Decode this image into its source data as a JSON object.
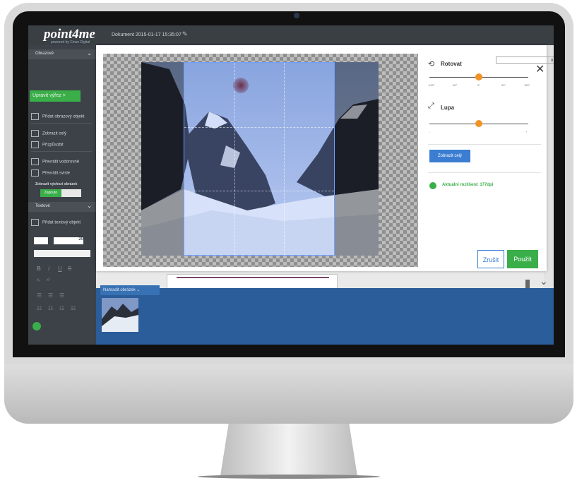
{
  "app": {
    "logo": "point4me",
    "logo_tagline": "powered by Cewe Digital",
    "document_name": "Dokument 2015-01-17 15:35:07"
  },
  "sidebar": {
    "image_section": "Obrazové",
    "crop_button": "Upravit výřez  >",
    "items": [
      {
        "label": "Přidat obrazový objekt",
        "icon": "add-image-icon"
      },
      {
        "label": "Zobrazit celý",
        "icon": "fit-icon"
      },
      {
        "label": "Přizpůsobit",
        "icon": "fill-icon"
      },
      {
        "label": "Převrátit vodorovně",
        "icon": "flip-horizontal-icon"
      },
      {
        "label": "Převrátit svisle",
        "icon": "flip-vertical-icon"
      }
    ],
    "show_original_label": "Zobrazit výchozí obrázek",
    "show_original_toggle": "Zapnuto",
    "text_section": "Textové",
    "add_text": "Přidat textový objekt",
    "font_size": "20",
    "format_glyphs": [
      "B",
      "I",
      "U",
      "S"
    ],
    "sub_glyphs": [
      "x₂",
      "x²"
    ]
  },
  "bottom": {
    "replace_tab": "Nahradit obrázek"
  },
  "modal": {
    "rotate_label": "Rotovat",
    "rotate_value": "0",
    "rotate_ticks": [
      "-180°",
      "-90°",
      "0°",
      "90°",
      "180°"
    ],
    "rotate_fraction": 0.5,
    "zoom_label": "Lupa",
    "zoom_ticks": [
      "-",
      "+"
    ],
    "zoom_fraction": 0.5,
    "show_full_button": "Zobrazit celý",
    "resolution_text": "Aktuální rozlišení: 177dpi",
    "cancel_button": "Zrušit",
    "apply_button": "Použít",
    "close_icon": "close-icon"
  },
  "colors": {
    "accent_green": "#3aae49",
    "accent_blue": "#3b7ed1",
    "slider_orange": "#f29326",
    "panel_blue": "#2a5d99"
  }
}
